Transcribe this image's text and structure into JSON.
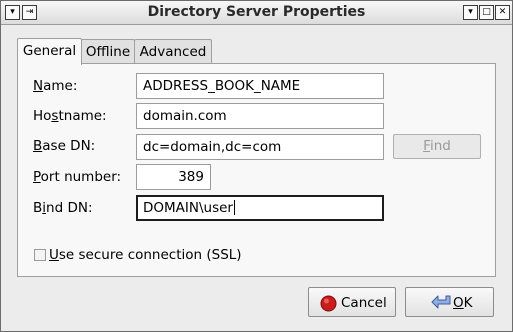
{
  "window": {
    "title": "Directory Server Properties"
  },
  "tabs": [
    {
      "label": "General",
      "active": true
    },
    {
      "label": "Offline",
      "active": false
    },
    {
      "label": "Advanced",
      "active": false
    }
  ],
  "form": {
    "name": {
      "label_u": "N",
      "label_rest": "ame:",
      "value": "ADDRESS_BOOK_NAME"
    },
    "hostname": {
      "label_pre": "Ho",
      "label_u": "s",
      "label_rest": "tname:",
      "value": "domain.com"
    },
    "base_dn": {
      "label_u": "B",
      "label_rest": "ase DN:",
      "value": "dc=domain,dc=com"
    },
    "port": {
      "label_u": "P",
      "label_rest": "ort number:",
      "value": "389"
    },
    "bind_dn": {
      "label_pre": "B",
      "label_u": "i",
      "label_rest": "nd DN:",
      "value": "DOMAIN\\user"
    },
    "find_button": {
      "label_u": "F",
      "label_rest": "ind"
    },
    "ssl": {
      "label_u": "U",
      "label_rest": "se secure connection (SSL)",
      "checked": false
    }
  },
  "buttons": {
    "cancel": {
      "label": "Cancel",
      "icon": "cancel-icon"
    },
    "ok": {
      "label_u": "O",
      "label_rest": "K",
      "icon": "ok-arrow-icon"
    }
  },
  "colors": {
    "cancel_icon": "#cc1b1b",
    "ok_icon": "#5a7fc4"
  }
}
